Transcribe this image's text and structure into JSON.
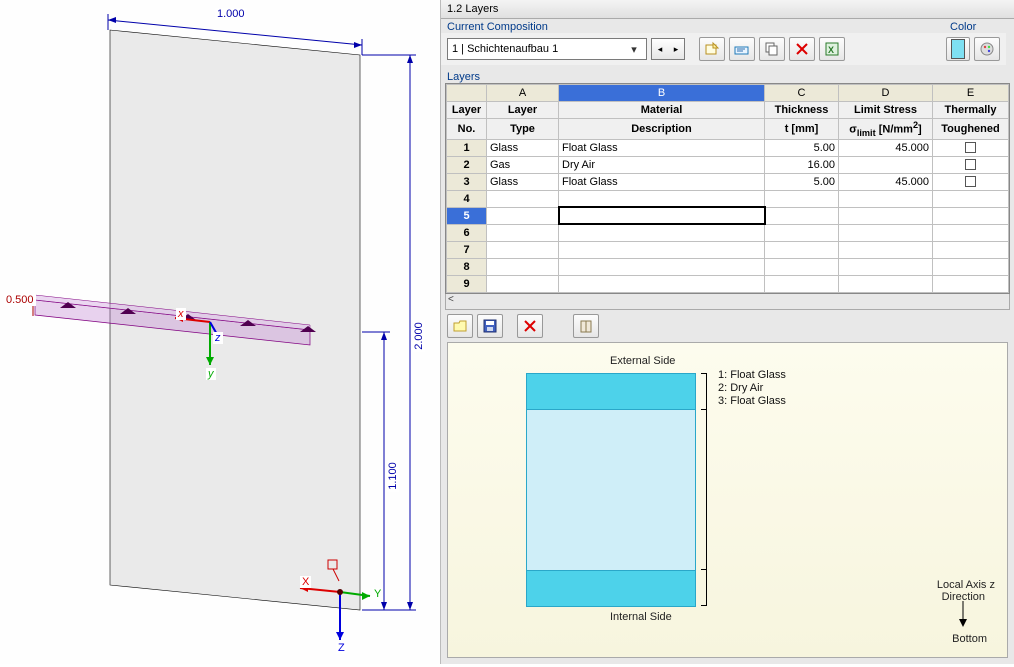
{
  "header": {
    "title": "1.2 Layers"
  },
  "composition": {
    "label": "Current Composition",
    "value": "1 | Schichtenaufbau 1",
    "color_label": "Color",
    "color_hex": "#7ee0f2"
  },
  "toolbar": {
    "new": "New",
    "rename": "Rename",
    "copy": "Copy",
    "delete": "Delete",
    "excel": "Export"
  },
  "layers_label": "Layers",
  "columns": {
    "letters": [
      "A",
      "B",
      "C",
      "D",
      "E"
    ],
    "row_head1": "Layer",
    "row_head2": "No.",
    "A1": "Layer",
    "A2": "Type",
    "B1": "Material",
    "B2": "Description",
    "C1": "Thickness",
    "C2": "t [mm]",
    "D1": "Limit Stress",
    "D2_pre": "σ",
    "D2_sub": "limit",
    "D2_post": " [N/mm",
    "D2_sup": "2",
    "D2_end": "]",
    "E1": "Thermally",
    "E2": "Toughened"
  },
  "rows": [
    {
      "no": "1",
      "type": "Glass",
      "mat": "Float Glass",
      "t": "5.00",
      "sigma": "45.000",
      "tough": false
    },
    {
      "no": "2",
      "type": "Gas",
      "mat": "Dry Air",
      "t": "16.00",
      "sigma": "",
      "tough": false
    },
    {
      "no": "3",
      "type": "Glass",
      "mat": "Float Glass",
      "t": "5.00",
      "sigma": "45.000",
      "tough": false
    },
    {
      "no": "4",
      "type": "",
      "mat": "",
      "t": "",
      "sigma": "",
      "tough": null
    },
    {
      "no": "5",
      "type": "",
      "mat": "",
      "t": "",
      "sigma": "",
      "tough": null,
      "selected": true
    },
    {
      "no": "6",
      "type": "",
      "mat": "",
      "t": "",
      "sigma": "",
      "tough": null
    },
    {
      "no": "7",
      "type": "",
      "mat": "",
      "t": "",
      "sigma": "",
      "tough": null
    },
    {
      "no": "8",
      "type": "",
      "mat": "",
      "t": "",
      "sigma": "",
      "tough": null
    },
    {
      "no": "9",
      "type": "",
      "mat": "",
      "t": "",
      "sigma": "",
      "tough": null
    }
  ],
  "row_toolbar": {
    "open": "Open",
    "save": "Save",
    "delete": "Delete",
    "lib": "Library"
  },
  "preview": {
    "external": "External Side",
    "internal": "Internal Side",
    "layer1": "1: Float Glass",
    "layer2": "2: Dry Air",
    "layer3": "3: Float Glass",
    "axis1": "Local Axis z",
    "axis2": "Direction",
    "bottom": "Bottom"
  },
  "dims": {
    "top": "1.000",
    "right_full": "2.000",
    "right_lower": "1.100",
    "left": "0.500",
    "x": "x",
    "y": "y",
    "z": "z",
    "X": "X",
    "Y": "Y",
    "Z": "Z"
  }
}
